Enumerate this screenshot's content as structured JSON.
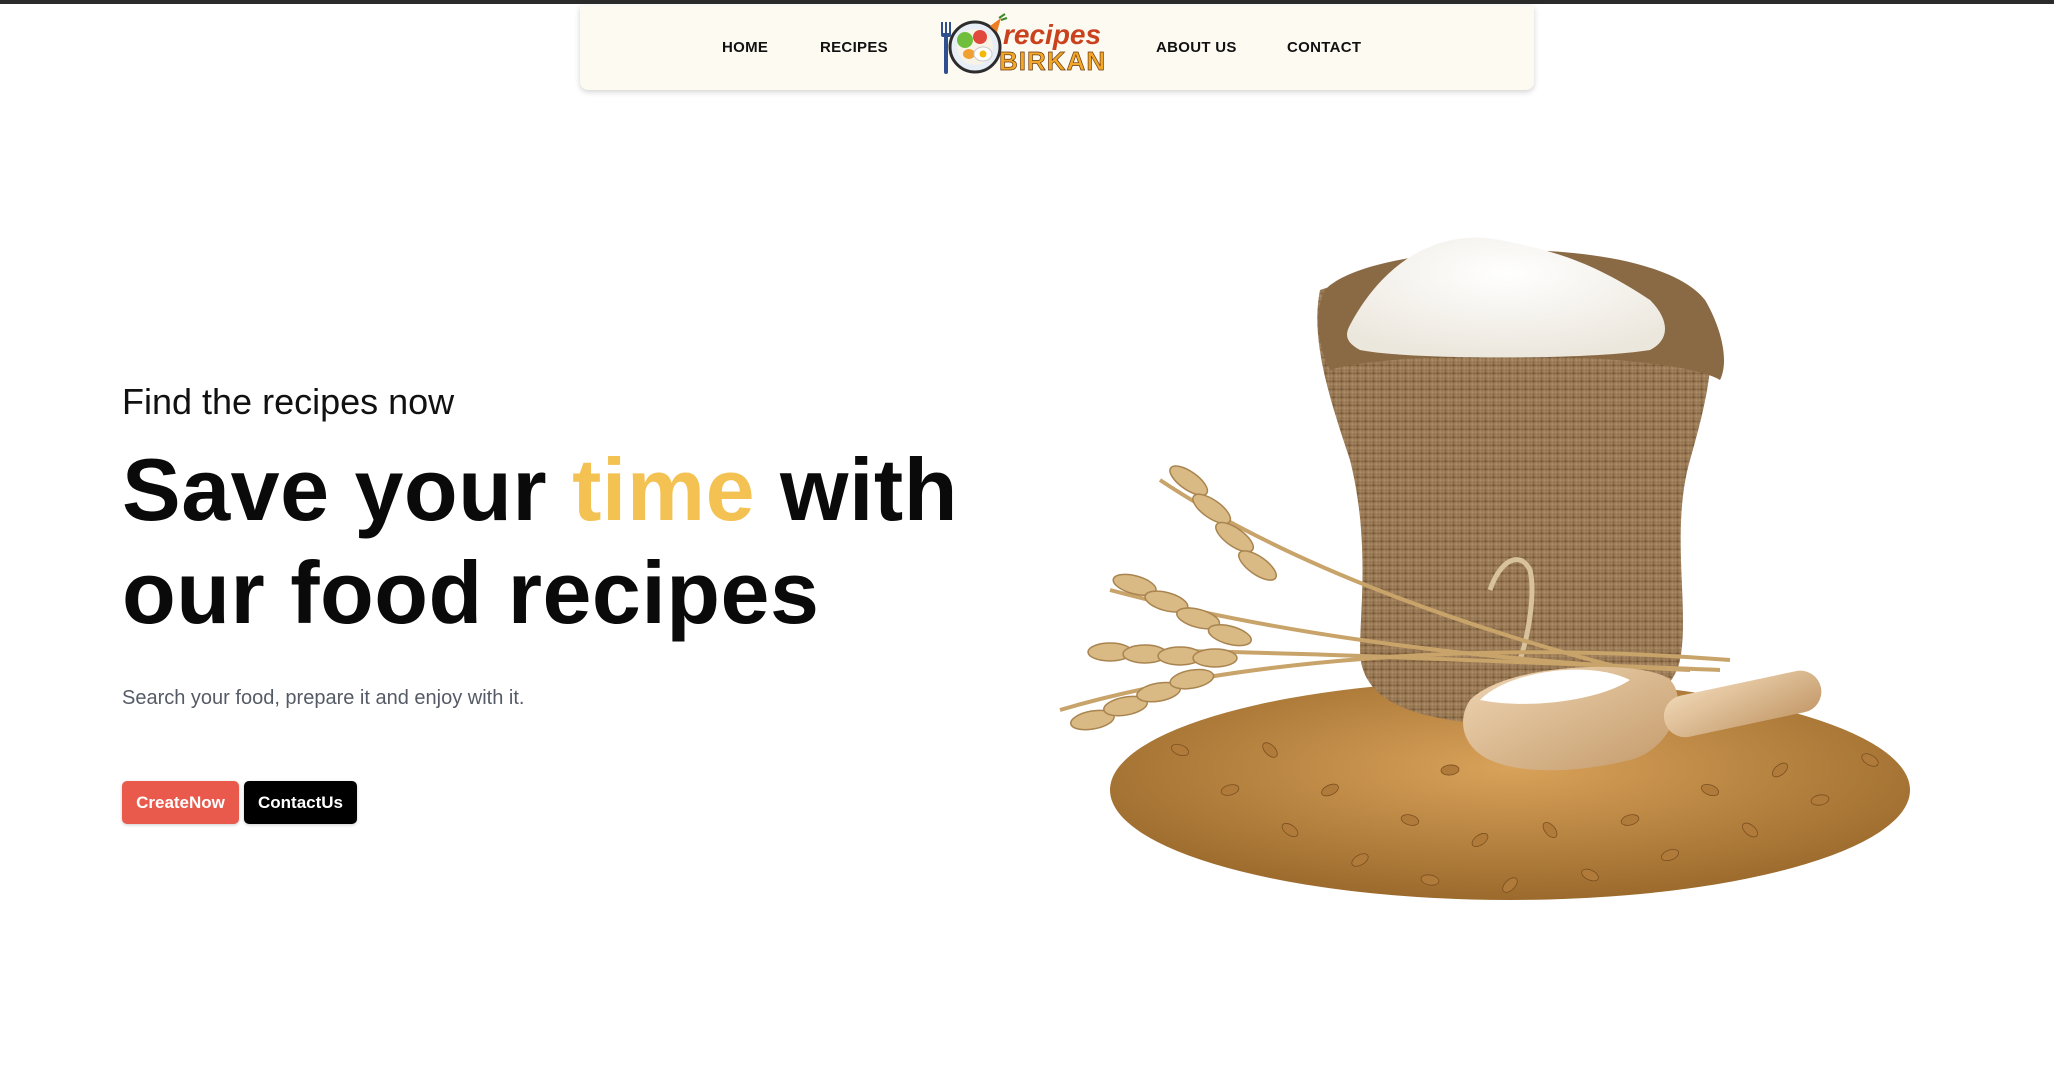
{
  "nav": {
    "home": "HOME",
    "recipes": "RECIPES",
    "about": "ABOUT US",
    "contact": "CONTACT",
    "logo_line1": "recipes",
    "logo_line2": "BIRKAN"
  },
  "hero": {
    "subtitle": "Find the recipes now",
    "title_part1": "Save your ",
    "title_accent": "time",
    "title_part2": " with our food recipes",
    "description": "Search your food, prepare it and enjoy with it.",
    "create_button": "CreateNow",
    "contact_button": "ContactUs"
  },
  "colors": {
    "accent": "#f4c252",
    "create_button": "#e95a4d",
    "contact_button": "#000000",
    "navbar_bg": "#fdfaf2",
    "description_text": "#555b66"
  },
  "image": {
    "semantic": "flour-sack-with-wheat-and-grains"
  }
}
